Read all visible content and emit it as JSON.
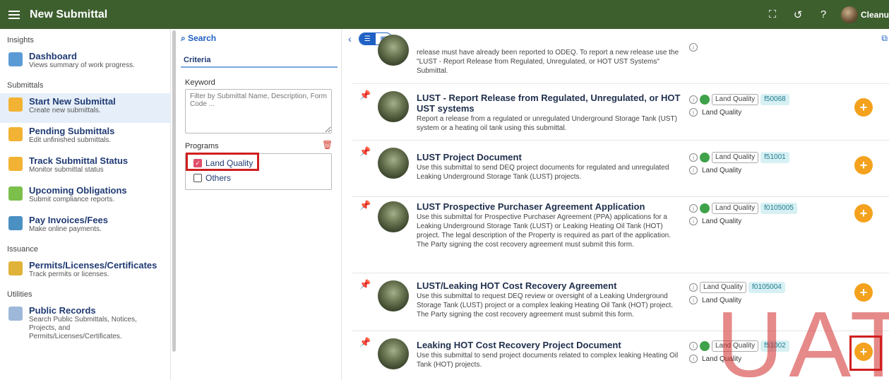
{
  "header": {
    "title": "New Submittal",
    "user": "Cleanu"
  },
  "sidebar": {
    "sections": [
      {
        "label": "Insights",
        "items": [
          {
            "title": "Dashboard",
            "subtitle": "Views summary of work progress."
          }
        ]
      },
      {
        "label": "Submittals",
        "items": [
          {
            "title": "Start New Submittal",
            "subtitle": "Create new submittals."
          },
          {
            "title": "Pending Submittals",
            "subtitle": "Edit unfinished submittals."
          },
          {
            "title": "Track Submittal Status",
            "subtitle": "Monitor submittal status"
          },
          {
            "title": "Upcoming Obligations",
            "subtitle": "Submit compliance reports."
          },
          {
            "title": "Pay Invoices/Fees",
            "subtitle": "Make online payments."
          }
        ]
      },
      {
        "label": "Issuance",
        "items": [
          {
            "title": "Permits/Licenses/Certificates",
            "subtitle": "Track permits or licenses."
          }
        ]
      },
      {
        "label": "Utilities",
        "items": [
          {
            "title": "Public Records",
            "subtitle": "Search Public Submittals, Notices, Projects, and Permits/Licenses/Certificates."
          }
        ]
      }
    ]
  },
  "criteria": {
    "search_label": "Search",
    "tab_label": "Criteria",
    "keyword_label": "Keyword",
    "keyword_placeholder": "Filter by Submittal Name, Description, Form Code ...",
    "programs_label": "Programs",
    "options": [
      {
        "label": "Land Quality",
        "checked": true
      },
      {
        "label": "Others",
        "checked": false
      }
    ]
  },
  "submittals": [
    {
      "title": "",
      "description": "release must have already been reported to ODEQ. To report a new release use the \"LUST - Report Release from Regulated, Unregulated, or HOT UST Systems\" Submittal.",
      "program": "",
      "code": "",
      "program_line": ""
    },
    {
      "title": "LUST - Report Release from Regulated, Unregulated, or HOT UST systems",
      "description": "Report a release from a regulated or unregulated Underground Storage Tank (UST) system or a heating oil tank using this submittal.",
      "program": "Land Quality",
      "code": "f50068",
      "program_line": "Land Quality"
    },
    {
      "title": "LUST Project Document",
      "description": "Use this submittal to send DEQ project documents for regulated and unregulated Leaking Underground Storage Tank (LUST) projects.",
      "program": "Land Quality",
      "code": "f51001",
      "program_line": "Land Quality"
    },
    {
      "title": "LUST Prospective Purchaser Agreement Application",
      "description": "Use this submittal for Prospective Purchaser Agreement (PPA) applications for a Leaking Underground Storage Tank (LUST) or Leaking Heating Oil Tank (HOT) project. The legal description of the Property is required as part of the application. The Party signing the cost recovery agreement must submit this form.",
      "program": "Land Quality",
      "code": "f0105005",
      "program_line": "Land Quality"
    },
    {
      "title": "LUST/Leaking HOT Cost Recovery Agreement",
      "description": "Use this submittal to request DEQ review or oversight of a Leaking Underground Storage Tank (LUST) project or a complex leaking Heating Oil Tank (HOT) project. The Party signing the cost recovery agreement must submit this form.",
      "program": "Land Quality",
      "code": "f0105004",
      "program_line": "Land Quality"
    },
    {
      "title": "Leaking HOT Cost Recovery Project Document",
      "description": "Use this submittal to send project documents related to complex leaking Heating Oil Tank (HOT) projects.",
      "program": "Land Quality",
      "code": "f51002",
      "program_line": "Land Quality"
    }
  ],
  "watermark": "UAT",
  "colors": {
    "header": "#3d5f2e",
    "accent": "#1f60c4",
    "add": "#f4a21d",
    "highlight": "#d01f1f"
  }
}
